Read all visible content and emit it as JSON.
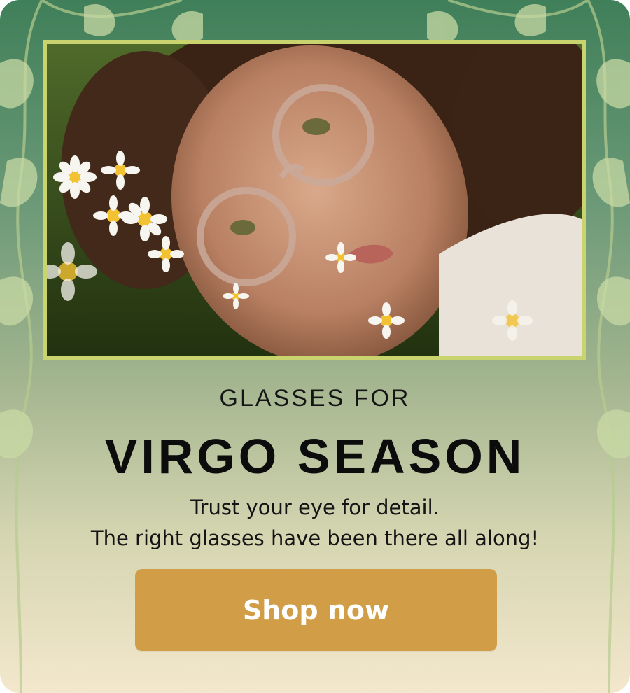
{
  "promo": {
    "kicker": "GLASSES FOR",
    "headline": "VIRGO SEASON",
    "body_line_1": "Trust your eye for detail.",
    "body_line_2": "The right glasses have been there all along!",
    "cta_label": "Shop now"
  },
  "colors": {
    "frame_border": "#c9d46e",
    "cta_background": "#d19d46",
    "cta_text": "#ffffff",
    "text": "#0c0c0c"
  },
  "icons": [
    "leaf-vine-ornament",
    "daisy-flower"
  ]
}
